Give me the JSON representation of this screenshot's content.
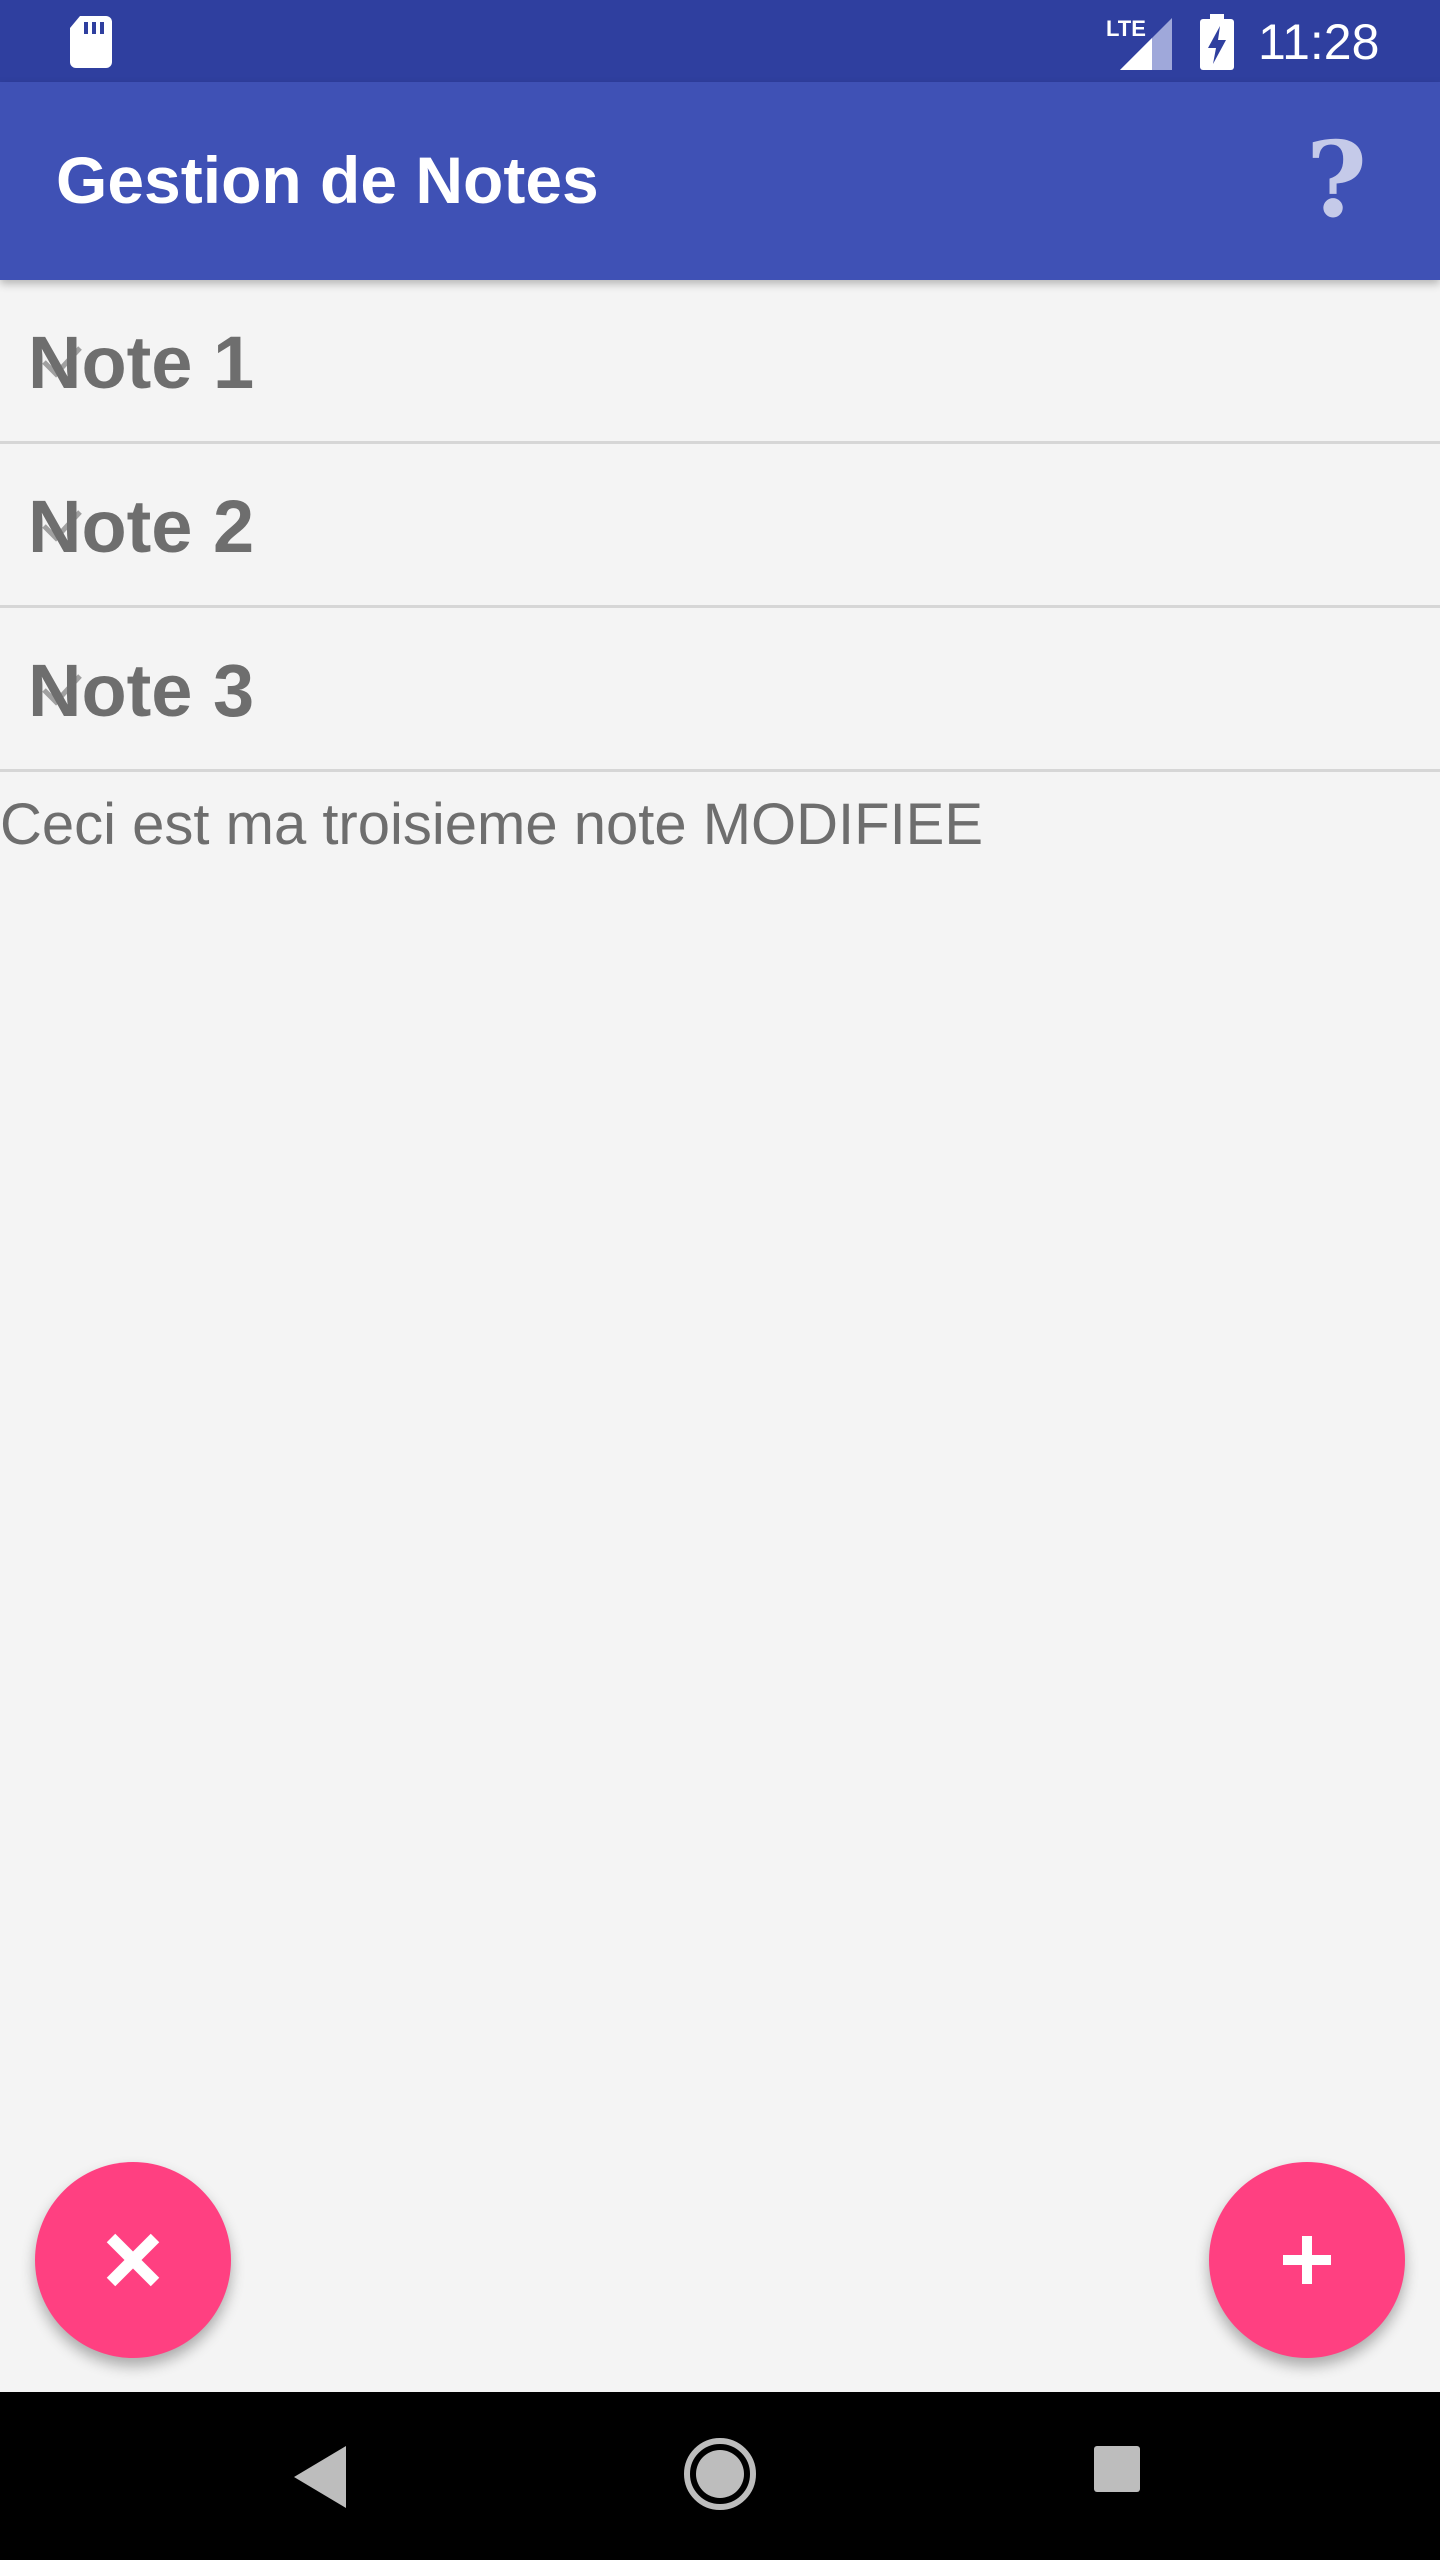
{
  "status_bar": {
    "time": "11:28",
    "network_label": "LTE",
    "icons": [
      "sd-card-icon",
      "lte-signal-icon",
      "battery-charging-icon"
    ]
  },
  "app_bar": {
    "title": "Gestion de Notes",
    "help_icon": "help-question-icon"
  },
  "notes": [
    {
      "title": "Note 1"
    },
    {
      "title": "Note 2"
    },
    {
      "title": "Note 3"
    }
  ],
  "selected_note_content": "Ceci est ma troisieme note MODIFIEE",
  "fabs": {
    "delete_icon": "close-icon",
    "add_icon": "plus-icon"
  },
  "nav_bar": {
    "icons": [
      "back-icon",
      "home-icon",
      "recents-icon"
    ]
  },
  "colors": {
    "status_bar": "#2f3f9f",
    "app_bar": "#3f51b5",
    "fab": "#ff4081",
    "background": "#f4f4f4",
    "text": "#6e6e6e"
  }
}
